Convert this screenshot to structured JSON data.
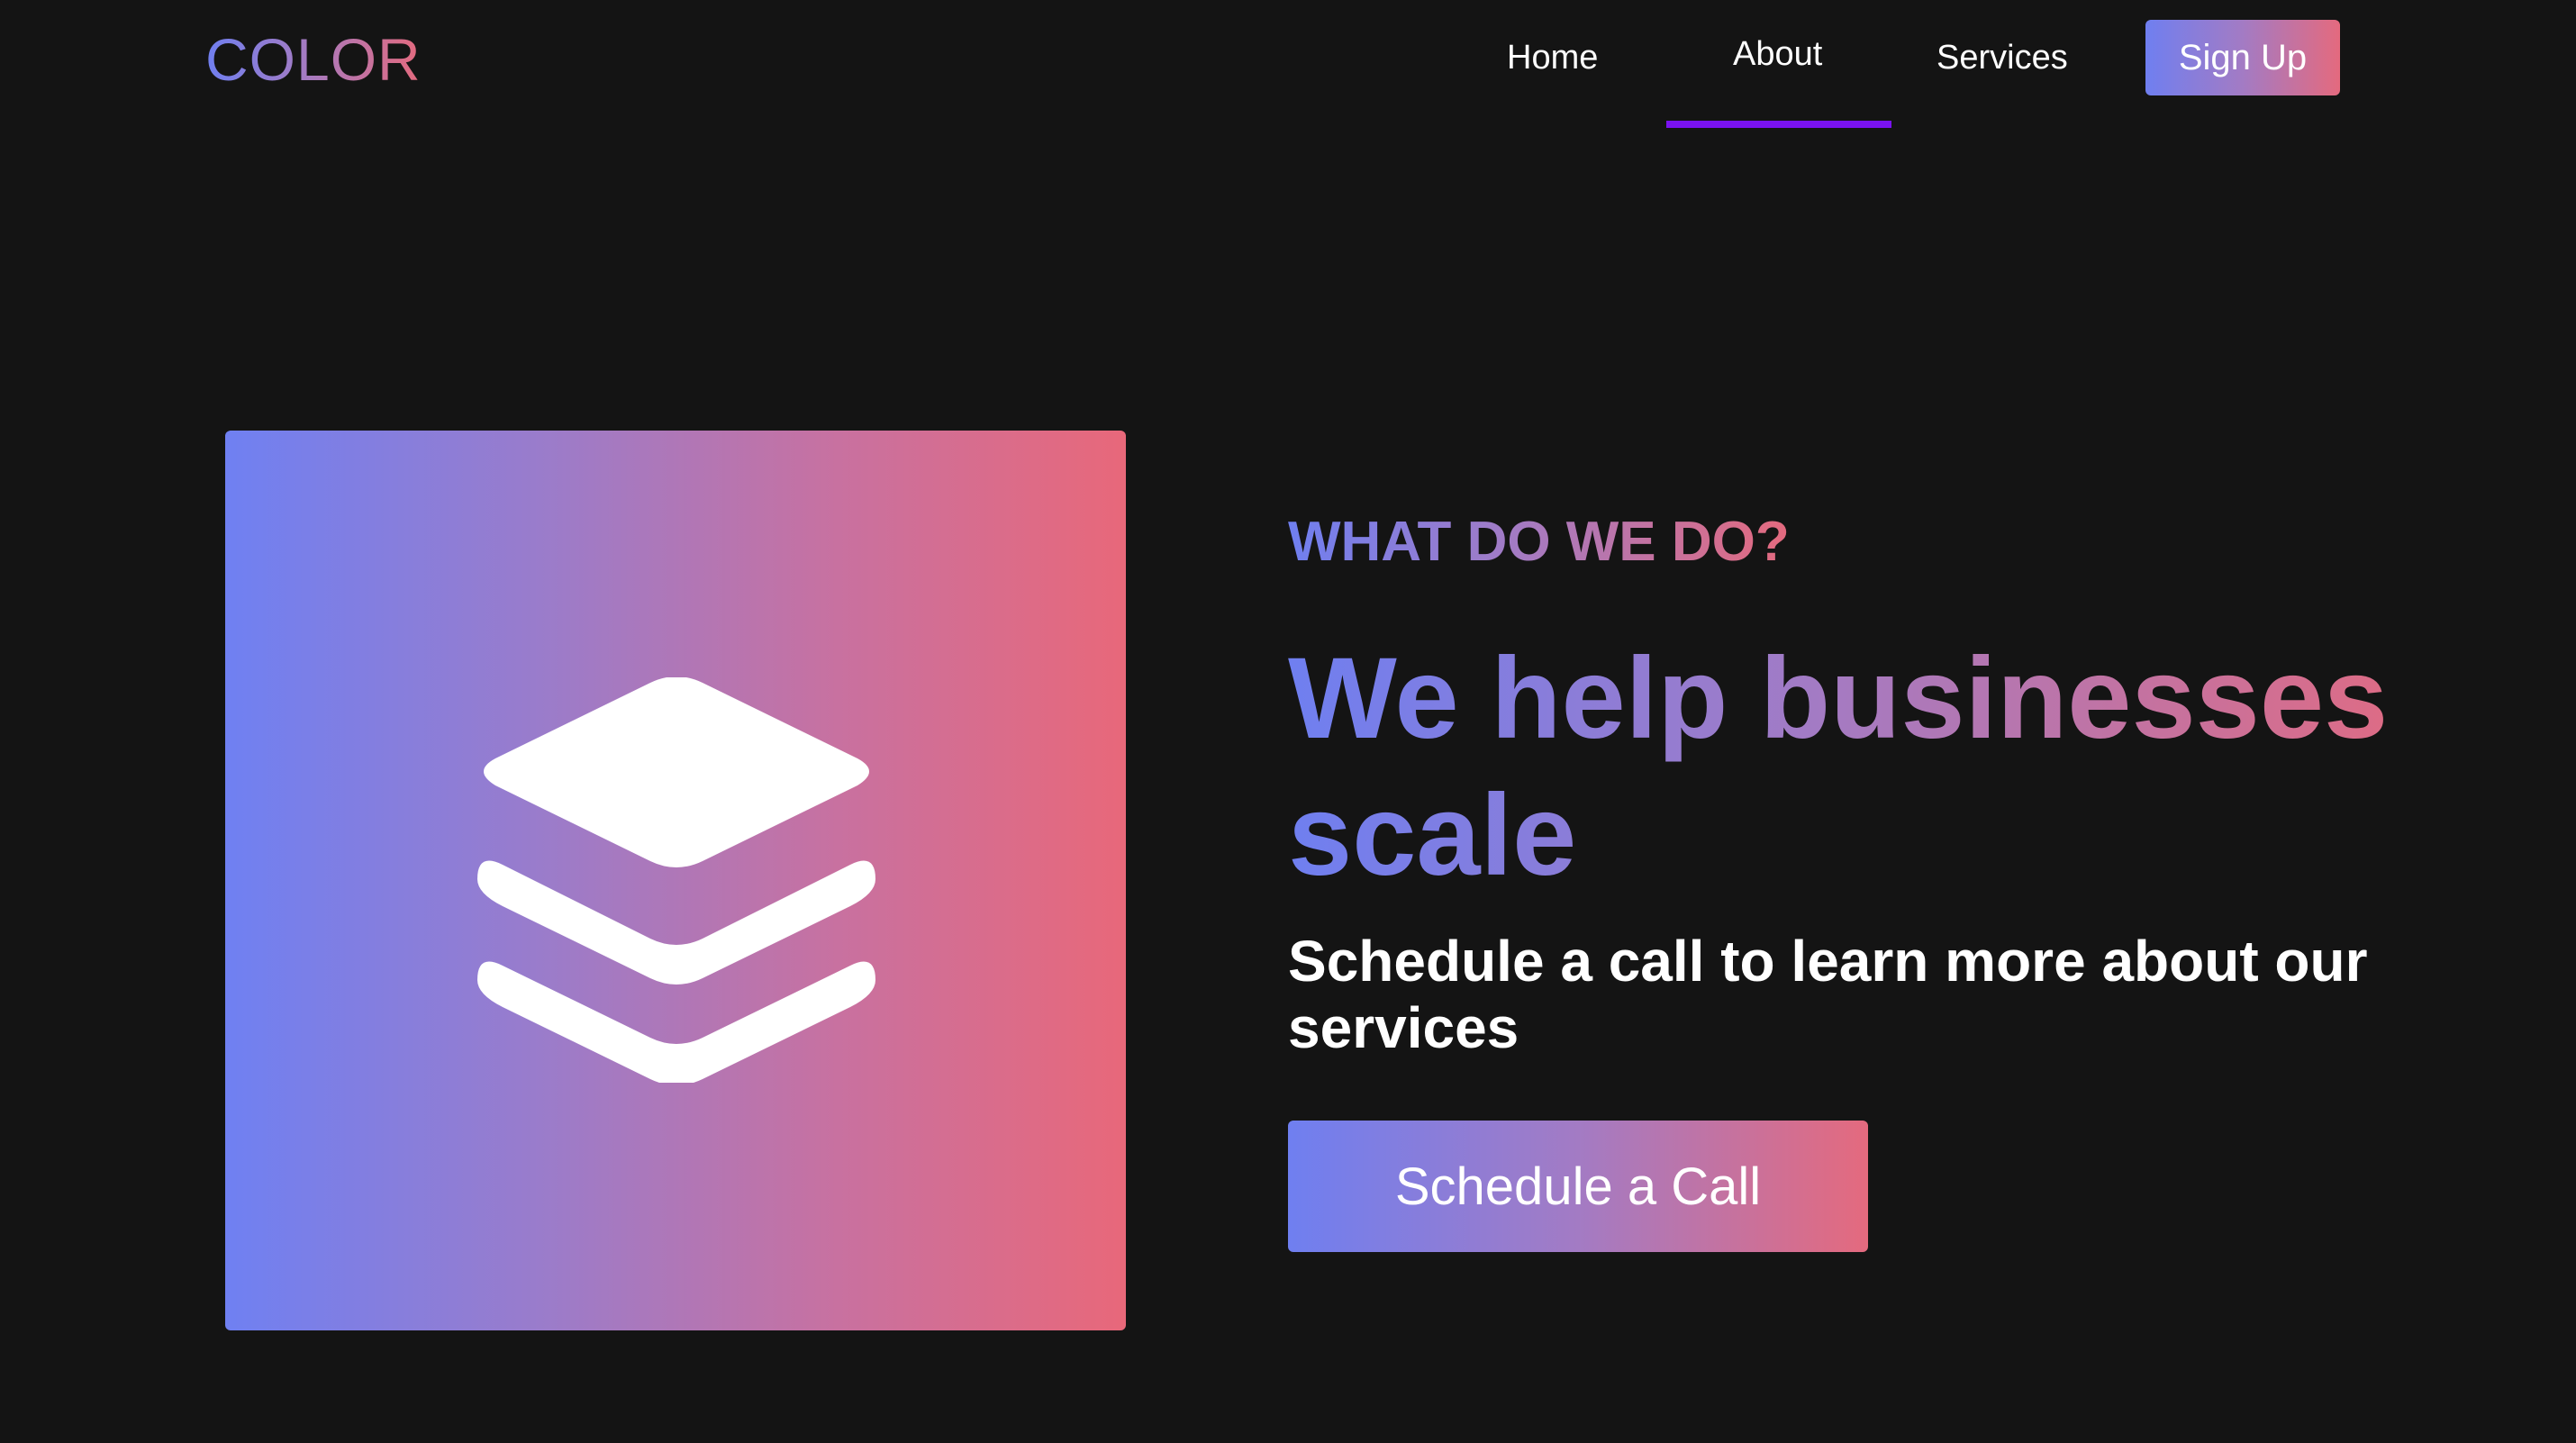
{
  "brand": {
    "logo_text": "COLOR",
    "gradient_start": "#6f7ff0",
    "gradient_mid": "#a37bc4",
    "gradient_end": "#e46a7e",
    "background": "#141414",
    "active_underline_color": "#7a12f0"
  },
  "nav": {
    "items": [
      {
        "label": "Home",
        "active": false
      },
      {
        "label": "About",
        "active": true
      },
      {
        "label": "Services",
        "active": false
      }
    ],
    "signup_label": "Sign Up"
  },
  "hero": {
    "icon": "layers-icon",
    "eyebrow": "WHAT DO WE DO?",
    "headline": "We help businesses scale",
    "subtitle": "Schedule a call to learn more about our services",
    "cta_label": "Schedule a Call"
  }
}
